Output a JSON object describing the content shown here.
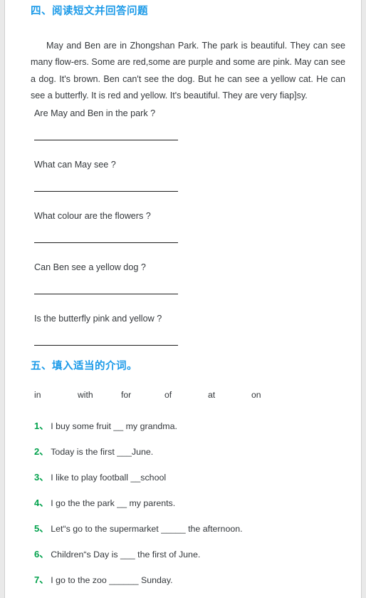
{
  "page": {
    "background_color": "#ffffff",
    "heading_color": "#1b9ae8",
    "number_color": "#00a14b",
    "text_color": "#33373b"
  },
  "section_four": {
    "heading": "四、阅读短文并回答问题",
    "passage": "May and Ben are in Zhongshan Park. The park is beautiful. They can see many flow-ers. Some are red,some are purple and some are pink. May can see a dog. It's brown. Ben can't see the dog. But he can see a yellow cat. He can see a butterfly. It is red and yellow. It's beautiful. They are very fiap]sy.",
    "questions": [
      "Are May and Ben in the park ?",
      "What can May see ?",
      "What colour are the flowers ?",
      "Can Ben see a yellow dog ?",
      "Is the butterfly pink and yellow ?"
    ]
  },
  "section_five": {
    "heading": "五、填入适当的介词。",
    "word_bank": [
      "in",
      "with",
      "for",
      "of",
      "at",
      "on"
    ],
    "items": [
      {
        "number": "1、",
        "text": "I buy some fruit __ my grandma."
      },
      {
        "number": "2、",
        "text": "Today is the first ___June."
      },
      {
        "number": "3、",
        "text": "I like to play football __school"
      },
      {
        "number": "4、",
        "text": "I go the the park __ my parents."
      },
      {
        "number": "5、",
        "text": "Let“s go to the supermarket _____ the afternoon."
      },
      {
        "number": "6、",
        "text": "Children“s Day is ___ the first of June."
      },
      {
        "number": "7、",
        "text": "I go to the zoo ______ Sunday."
      }
    ]
  }
}
